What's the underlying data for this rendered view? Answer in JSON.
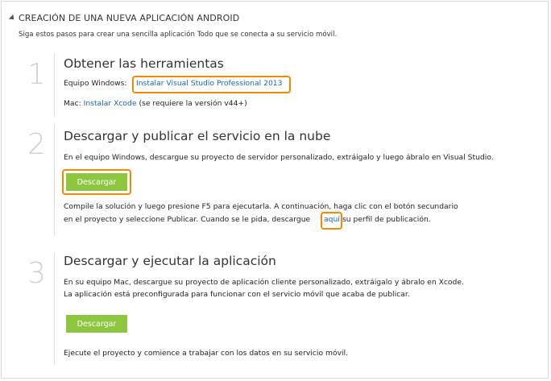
{
  "header": {
    "title": "CREACIÓN DE UNA NUEVA APLICACIÓN ANDROID",
    "intro": "Siga estos pasos para crear una sencilla aplicación Todo que se conecta a su servicio móvil."
  },
  "step1": {
    "number": "1",
    "heading": "Obtener las herramientas",
    "win_prefix": "Equipo Windows:",
    "win_link": "Instalar Visual Studio Professional 2013",
    "mac_prefix": "Mac:",
    "mac_link": "Instalar Xcode",
    "mac_suffix": "(se requiere la versión v44+)"
  },
  "step2": {
    "number": "2",
    "heading": "Descargar y publicar el servicio en la nube",
    "desc": "En el equipo Windows, descargue su proyecto de servidor personalizado, extráigalo y luego ábralo en Visual Studio.",
    "button": "Descargar",
    "line1": "Compile la solución y luego presione F5 para ejecutarla. A continuación, haga clic con el botón secundario",
    "line2_prefix": "en el proyecto y seleccione Publicar. Cuando se le pida, descargue",
    "line2_link": "aquí",
    "line2_suffix": "su perfil de publicación."
  },
  "step3": {
    "number": "3",
    "heading": "Descargar y ejecutar la aplicación",
    "desc1": "En su equipo Mac, descargue su proyecto de aplicación cliente personalizado, extráigalo y ábralo en Xcode.",
    "desc2": "La aplicación está preconfigurada para funcionar con el servicio móvil que acaba de publicar.",
    "button": "Descargar",
    "footer": "Ejecute el proyecto y comience a trabajar con los datos en su servicio móvil."
  },
  "colors": {
    "accent_green": "#8dc63f",
    "highlight_orange": "#f08a00",
    "link_blue": "#1a64b4"
  }
}
